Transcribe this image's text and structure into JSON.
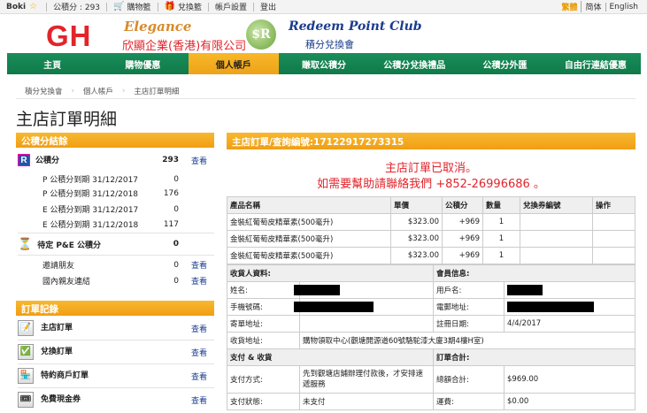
{
  "topbar": {
    "user": "Boki",
    "points_label": "公積分 : 293",
    "cart": "購物籃",
    "redeem_cart": "兌換籃",
    "account_settings": "帳戶設置",
    "logout": "登出",
    "lang_trad": "繁體",
    "lang_simp": "简体",
    "lang_en": "English"
  },
  "header": {
    "logo": "GH",
    "elegance": "Elegance",
    "company": "欣顯企業(香港)有限公司",
    "club": "Redeem Point Club",
    "club_sub": "積分兌換會"
  },
  "nav": [
    "主頁",
    "購物優惠",
    "個人帳戶",
    "賺取公積分",
    "公積分兌換禮品",
    "公積分外匯",
    "自由行連結優惠"
  ],
  "nav_active": 2,
  "breadcrumb": [
    "積分兌換會",
    "個人帳戶",
    "主店訂單明細"
  ],
  "page_title": "主店訂單明細",
  "points_summary": {
    "header": "公積分結餘",
    "total_label": "公積分",
    "total_value": "293",
    "view": "查看",
    "rows": [
      {
        "label": "P 公積分到期 31/12/2017",
        "value": "0"
      },
      {
        "label": "P 公積分到期 31/12/2018",
        "value": "176"
      },
      {
        "label": "E 公積分到期 31/12/2017",
        "value": "0"
      },
      {
        "label": "E 公積分到期 31/12/2018",
        "value": "117"
      }
    ],
    "pending_label": "待定 P&E 公積分",
    "pending_value": "0",
    "invite_label": "邀請朋友",
    "invite_value": "0",
    "referral_label": "國內親友連結",
    "referral_value": "0"
  },
  "orders_menu": {
    "header": "訂單記錄",
    "items": [
      {
        "label": "主店訂單",
        "link": "查看"
      },
      {
        "label": "兌換訂單",
        "link": "查看"
      },
      {
        "label": "特約商戶訂單",
        "link": "查看"
      },
      {
        "label": "免費現金券",
        "link": "查看"
      }
    ]
  },
  "order": {
    "header": "主店訂單/查詢編號:17122917273315",
    "cancel_line1": "主店訂單已取消。",
    "cancel_line2": "如需要幫助請聯絡我們 +852-26996686 。",
    "columns": [
      "產品名稱",
      "單價",
      "公積分",
      "數量",
      "兌換券編號",
      "操作"
    ],
    "items": [
      {
        "name": "金裝紅葡萄皮精華素(500毫升)",
        "price": "$323.00",
        "points": "+969",
        "qty": "1"
      },
      {
        "name": "金裝紅葡萄皮精華素(500毫升)",
        "price": "$323.00",
        "points": "+969",
        "qty": "1"
      },
      {
        "name": "金裝紅葡萄皮精華素(500毫升)",
        "price": "$323.00",
        "points": "+969",
        "qty": "1"
      }
    ],
    "recipient_header": "收貨人資料:",
    "member_header": "會員信息:",
    "name_label": "姓名:",
    "username_label": "用戶名:",
    "mobile_label": "手機號碼:",
    "email_label": "電郵地址:",
    "mail_addr_label": "寄單地址:",
    "reg_date_label": "註冊日期:",
    "reg_date": "4/4/2017",
    "ship_addr_label": "收貨地址:",
    "ship_addr": "購物領取中心(觀塘開源道60號駱駝漆大廈3期4樓H室)",
    "payment_header": "支付 & 收貨",
    "total_header": "訂單合計:",
    "pay_method_label": "支付方式:",
    "pay_method": "先到觀塘店鋪辦理付款後，才安排速遞服務",
    "amount_label": "總額合計:",
    "amount": "$969.00",
    "pay_status_label": "支付狀態:",
    "pay_status": "未支付",
    "shipping_label": "運費:",
    "shipping": "$0.00"
  }
}
